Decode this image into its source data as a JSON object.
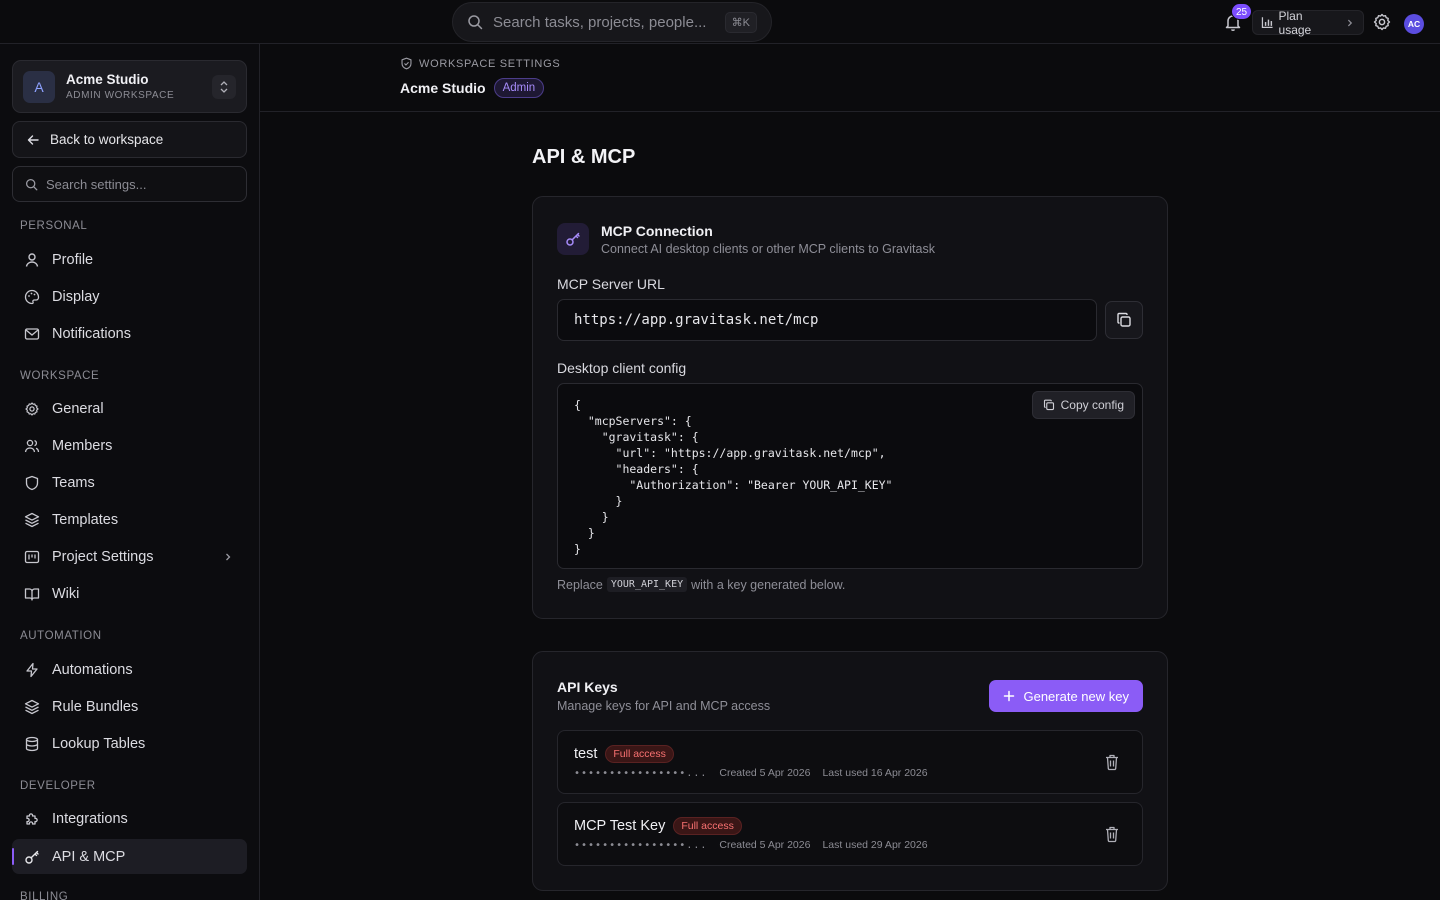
{
  "topbar": {
    "search_placeholder": "Search tasks, projects, people...",
    "shortcut": "⌘K",
    "notification_count": "25",
    "plan_usage_label": "Plan usage",
    "avatar_initials": "AC"
  },
  "sidebar": {
    "workspace": {
      "logo_letter": "A",
      "name": "Acme Studio",
      "subtitle": "ADMIN WORKSPACE"
    },
    "back_label": "Back to workspace",
    "search_placeholder": "Search settings...",
    "sections": {
      "personal": "PERSONAL",
      "workspace": "WORKSPACE",
      "automation": "AUTOMATION",
      "developer": "DEVELOPER",
      "billing": "BILLING"
    },
    "items": {
      "profile": "Profile",
      "display": "Display",
      "notifications": "Notifications",
      "general": "General",
      "members": "Members",
      "teams": "Teams",
      "templates": "Templates",
      "project_settings": "Project Settings",
      "wiki": "Wiki",
      "automations": "Automations",
      "rule_bundles": "Rule Bundles",
      "lookup_tables": "Lookup Tables",
      "integrations": "Integrations",
      "api_mcp": "API & MCP"
    }
  },
  "header": {
    "breadcrumb": "WORKSPACE SETTINGS",
    "title": "Acme Studio",
    "role_badge": "Admin"
  },
  "main": {
    "title": "API & MCP",
    "mcp": {
      "title": "MCP Connection",
      "subtitle": "Connect AI desktop clients or other MCP clients to Gravitask",
      "url_label": "MCP Server URL",
      "url_value": "https://app.gravitask.net/mcp",
      "config_label": "Desktop client config",
      "copy_config_label": "Copy config",
      "config_code": "{\n  \"mcpServers\": {\n    \"gravitask\": {\n      \"url\": \"https://app.gravitask.net/mcp\",\n      \"headers\": {\n        \"Authorization\": \"Bearer YOUR_API_KEY\"\n      }\n    }\n  }\n}",
      "hint_prefix": "Replace",
      "hint_code": "YOUR_API_KEY",
      "hint_suffix": "with a key generated below."
    },
    "api_keys": {
      "title": "API Keys",
      "subtitle": "Manage keys for API and MCP access",
      "generate_label": "Generate new key",
      "keys": [
        {
          "name": "test",
          "access": "Full access",
          "masked": "••••••••••••••••...",
          "created": "Created 5 Apr 2026",
          "last_used": "Last used 16 Apr 2026"
        },
        {
          "name": "MCP Test Key",
          "access": "Full access",
          "masked": "••••••••••••••••...",
          "created": "Created 5 Apr 2026",
          "last_used": "Last used 29 Apr 2026"
        }
      ]
    }
  },
  "colors": {
    "accent": "#8b5cf6",
    "danger": "#f87171",
    "background": "#0b0b0d",
    "card": "#111115"
  }
}
